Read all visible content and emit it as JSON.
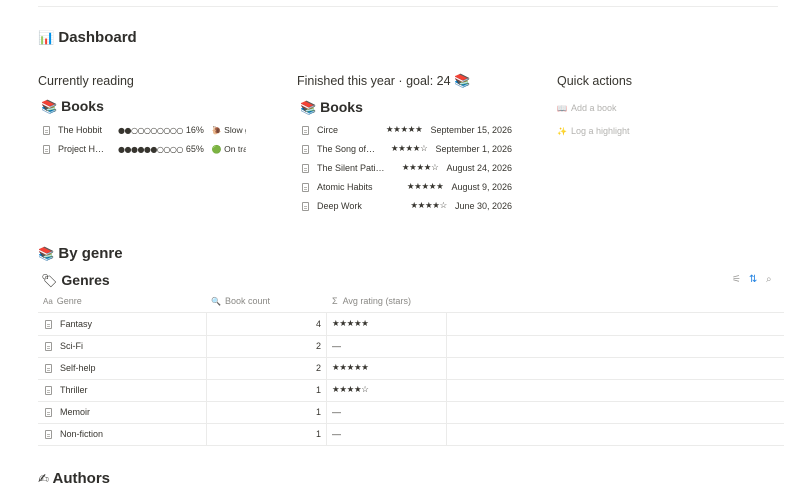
{
  "page": {
    "title": "Dashboard",
    "title_icon": "📊"
  },
  "currently_reading": {
    "heading": "Currently reading",
    "db_icon": "📚",
    "db_title": "Books",
    "rows": [
      {
        "title": "The Hobbit",
        "progress": "●●○○○○○○○○",
        "percent": "16%",
        "status_icon": "🐌",
        "status": "Slow g"
      },
      {
        "title": "Project H…",
        "progress": "●●●●●●○○○○",
        "percent": "65%",
        "status_icon": "🟢",
        "status": "On tra"
      }
    ]
  },
  "finished": {
    "heading": "Finished this year · goal: 24",
    "heading_icon": "📚",
    "db_icon": "📚",
    "db_title": "Books",
    "rows": [
      {
        "title": "Circe",
        "stars": "★★★★★",
        "date": "September 15, 2026"
      },
      {
        "title": "The Song of…",
        "stars": "★★★★☆",
        "date": "September 1, 2026"
      },
      {
        "title": "The Silent Pati…",
        "stars": "★★★★☆",
        "date": "August 24, 2026"
      },
      {
        "title": "Atomic Habits",
        "stars": "★★★★★",
        "date": "August 9, 2026"
      },
      {
        "title": "Deep Work",
        "stars": "★★★★☆",
        "date": "June 30, 2026"
      }
    ]
  },
  "quick_actions": {
    "heading": "Quick actions",
    "items": [
      {
        "icon": "📖",
        "label": "Add a book"
      },
      {
        "icon": "✨",
        "label": "Log a highlight"
      }
    ]
  },
  "by_genre": {
    "heading": "By genre",
    "heading_icon": "📚",
    "db_icon": "🏷",
    "db_title": "Genres",
    "columns": [
      {
        "icon": "Aa",
        "label": "Genre"
      },
      {
        "icon": "🔍",
        "label": "Book count"
      },
      {
        "icon": "Σ",
        "label": "Avg rating (stars)"
      }
    ],
    "rows": [
      {
        "genre": "Fantasy",
        "count": "4",
        "rating": "★★★★★"
      },
      {
        "genre": "Sci-Fi",
        "count": "2",
        "rating": "—"
      },
      {
        "genre": "Self-help",
        "count": "2",
        "rating": "★★★★★"
      },
      {
        "genre": "Thriller",
        "count": "1",
        "rating": "★★★★☆"
      },
      {
        "genre": "Memoir",
        "count": "1",
        "rating": "—"
      },
      {
        "genre": "Non-fiction",
        "count": "1",
        "rating": "—"
      }
    ],
    "toolbar": {
      "filter_icon": "⚟",
      "sort_icon": "⇅",
      "search_icon": "⌕"
    },
    "accent": "#2383e2"
  },
  "authors": {
    "heading": "Authors",
    "heading_icon": "✍"
  }
}
